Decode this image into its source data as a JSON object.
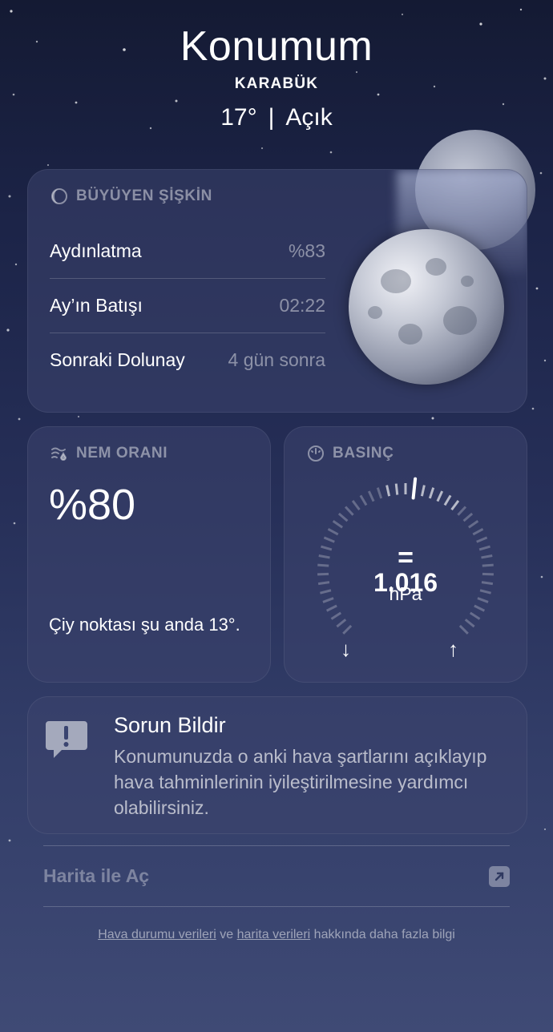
{
  "header": {
    "location": "Konumum",
    "city": "KARABÜK",
    "temperature": "17°",
    "separator": "|",
    "condition": "Açık"
  },
  "moon": {
    "phase_title": "BÜYÜYEN ŞİŞKİN",
    "rows": [
      {
        "label": "Aydınlatma",
        "value": "%83"
      },
      {
        "label": "Ay’ın Batışı",
        "value": "02:22"
      },
      {
        "label": "Sonraki Dolunay",
        "value": "4 gün sonra"
      }
    ],
    "icon": "moon-phase-icon"
  },
  "humidity": {
    "title": "NEM ORANI",
    "value": "%80",
    "note": "Çiy noktası şu anda 13°.",
    "icon": "humidity-icon"
  },
  "pressure": {
    "title": "BASINÇ",
    "value": "1.016",
    "unit": "hPa",
    "trend_symbol": "=",
    "low_arrow": "↓",
    "high_arrow": "↑",
    "icon": "gauge-icon"
  },
  "report": {
    "title": "Sorun Bildir",
    "text": "Konumunuzda o anki hava şartlarını açıklayıp hava tahminlerinin iyileştirilmesine yardımcı olabilirsiniz.",
    "icon": "report-bubble-icon"
  },
  "map": {
    "label": "Harita ile Aç",
    "icon": "external-link-icon"
  },
  "footer": {
    "link1": "Hava durumu verileri",
    "and": "ve",
    "link2": "harita verileri",
    "rest": "hakkında daha fazla bilgi"
  }
}
